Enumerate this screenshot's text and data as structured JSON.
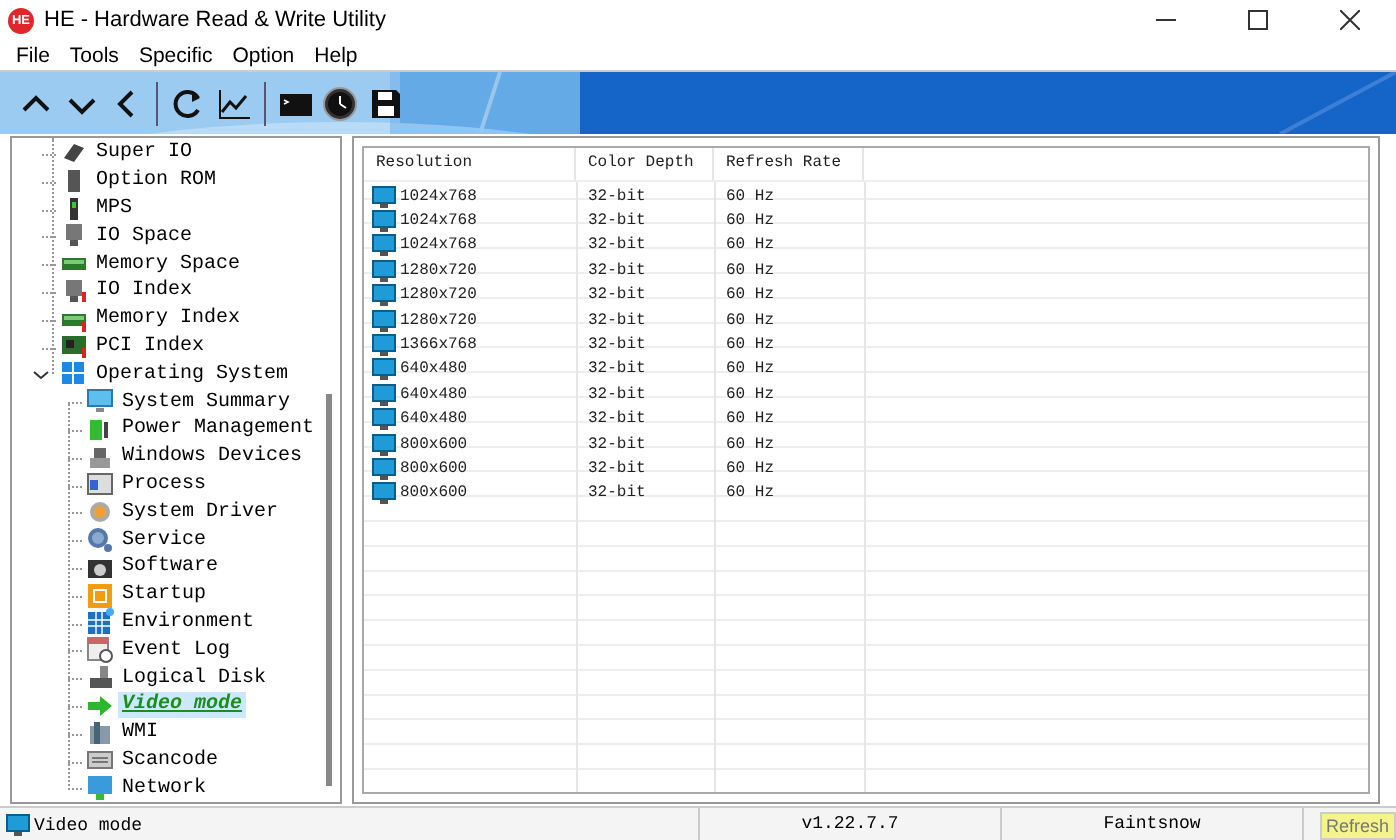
{
  "window": {
    "logo": "HE",
    "title": "HE - Hardware Read & Write Utility"
  },
  "menu": [
    "File",
    "Tools",
    "Specific",
    "Option",
    "Help"
  ],
  "tree": {
    "items": [
      {
        "label": "Super IO",
        "selected": false
      },
      {
        "label": "Option ROM",
        "selected": false
      },
      {
        "label": "MPS",
        "selected": false
      },
      {
        "label": "IO Space",
        "selected": false
      },
      {
        "label": "Memory Space",
        "selected": false
      },
      {
        "label": "IO Index",
        "selected": false
      },
      {
        "label": "Memory Index",
        "selected": false
      },
      {
        "label": "PCI Index",
        "selected": false
      },
      {
        "label": "Operating System",
        "selected": false,
        "expanded": true,
        "children": [
          {
            "label": "System Summary",
            "selected": false
          },
          {
            "label": "Power Management",
            "selected": false
          },
          {
            "label": "Windows Devices",
            "selected": false
          },
          {
            "label": "Process",
            "selected": false
          },
          {
            "label": "System Driver",
            "selected": false
          },
          {
            "label": "Service",
            "selected": false
          },
          {
            "label": "Software",
            "selected": false
          },
          {
            "label": "Startup",
            "selected": false
          },
          {
            "label": "Environment",
            "selected": false
          },
          {
            "label": "Event Log",
            "selected": false
          },
          {
            "label": "Logical Disk",
            "selected": false
          },
          {
            "label": "Video mode",
            "selected": true
          },
          {
            "label": "WMI",
            "selected": false
          },
          {
            "label": "Scancode",
            "selected": false
          },
          {
            "label": "Network",
            "selected": false
          }
        ]
      }
    ]
  },
  "table": {
    "columns": [
      "Resolution",
      "Color Depth",
      "Refresh Rate"
    ],
    "rows": [
      [
        "1024x768",
        "32-bit",
        "60 Hz"
      ],
      [
        "1024x768",
        "32-bit",
        "60 Hz"
      ],
      [
        "1024x768",
        "32-bit",
        "60 Hz"
      ],
      [
        "1280x720",
        "32-bit",
        "60 Hz"
      ],
      [
        "1280x720",
        "32-bit",
        "60 Hz"
      ],
      [
        "1280x720",
        "32-bit",
        "60 Hz"
      ],
      [
        "1366x768",
        "32-bit",
        "60 Hz"
      ],
      [
        "640x480",
        "32-bit",
        "60 Hz"
      ],
      [
        "640x480",
        "32-bit",
        "60 Hz"
      ],
      [
        "640x480",
        "32-bit",
        "60 Hz"
      ],
      [
        "800x600",
        "32-bit",
        "60 Hz"
      ],
      [
        "800x600",
        "32-bit",
        "60 Hz"
      ],
      [
        "800x600",
        "32-bit",
        "60 Hz"
      ]
    ]
  },
  "status_bar": {
    "current": "Video mode",
    "version": "v1.22.7.7",
    "author": "Faintsnow",
    "refresh_button": "Refresh"
  }
}
